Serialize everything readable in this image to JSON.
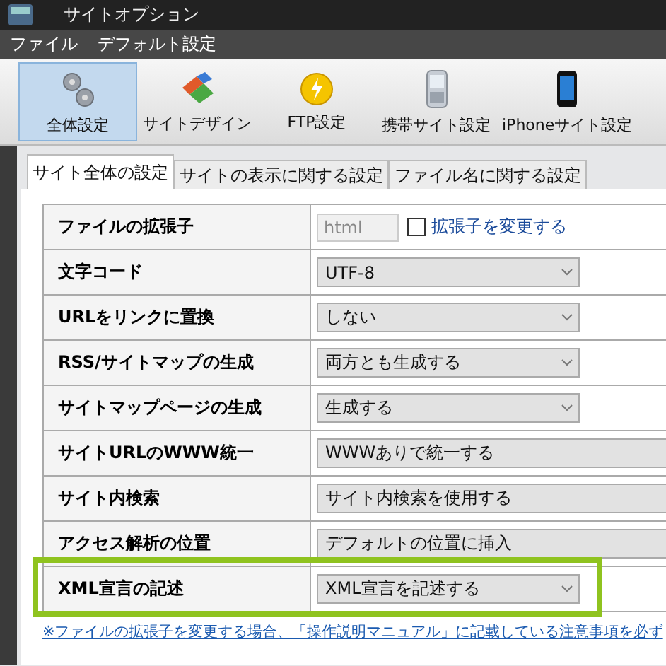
{
  "window": {
    "title": "サイトオプション"
  },
  "menu": [
    "ファイル",
    "デフォルト設定"
  ],
  "toolbar": [
    {
      "label": "全体設定",
      "selected": true
    },
    {
      "label": "サイトデザイン",
      "selected": false
    },
    {
      "label": "FTP設定",
      "selected": false
    },
    {
      "label": "携帯サイト設定",
      "selected": false
    },
    {
      "label": "iPhoneサイト設定",
      "selected": false
    }
  ],
  "tabs": [
    {
      "label": "サイト全体の設定",
      "selected": true
    },
    {
      "label": "サイトの表示に関する設定",
      "selected": false
    },
    {
      "label": "ファイル名に関する設定",
      "selected": false
    }
  ],
  "rows": [
    {
      "label": "ファイルの拡張子",
      "kind": "text",
      "value": "html",
      "disabled": true,
      "checkbox": {
        "label": "拡張子を変更する",
        "checked": false
      }
    },
    {
      "label": "文字コード",
      "kind": "select",
      "value": "UTF-8",
      "wide": false,
      "highlighted": false
    },
    {
      "label": "URLをリンクに置換",
      "kind": "select",
      "value": "しない",
      "wide": false,
      "highlighted": false
    },
    {
      "label": "RSS/サイトマップの生成",
      "kind": "select",
      "value": "両方とも生成する",
      "wide": false,
      "highlighted": false
    },
    {
      "label": "サイトマップページの生成",
      "kind": "select",
      "value": "生成する",
      "wide": false,
      "highlighted": false
    },
    {
      "label": "サイトURLのWWW統一",
      "kind": "select",
      "value": "WWWありで統一する",
      "wide": true,
      "highlighted": false
    },
    {
      "label": "サイト内検索",
      "kind": "select",
      "value": "サイト内検索を使用する",
      "wide": true,
      "highlighted": false
    },
    {
      "label": "アクセス解析の位置",
      "kind": "select",
      "value": "デフォルトの位置に挿入",
      "wide": true,
      "highlighted": false
    },
    {
      "label": "XML宣言の記述",
      "kind": "select",
      "value": "XML宣言を記述する",
      "wide": false,
      "highlighted": true
    }
  ],
  "note": "※ファイルの拡張子を変更する場合、「操作説明マニュアル」に記載している注意事項を必ず"
}
